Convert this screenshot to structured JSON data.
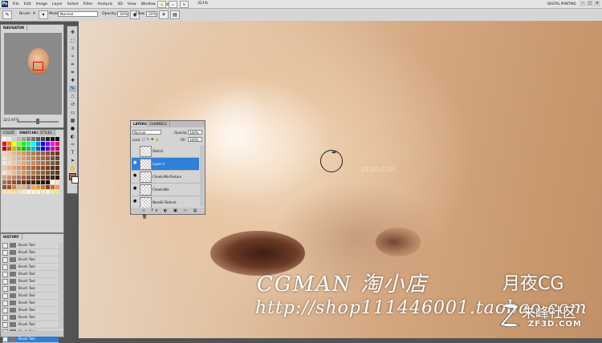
{
  "menubar": {
    "logo": "Ps",
    "menus": [
      "File",
      "Edit",
      "Image",
      "Layer",
      "Select",
      "Filter",
      "Analysis",
      "3D",
      "View",
      "Window",
      "Help"
    ],
    "zoom": "321%",
    "workspace": "DIGITAL PAINTING"
  },
  "options": {
    "brush_label": "Brush:",
    "brush_size": "9",
    "mode_label": "Mode:",
    "mode_value": "Normal",
    "opacity_label": "Opacity:",
    "opacity_value": "30%",
    "flow_label": "Flow:",
    "flow_value": "20%"
  },
  "navigator": {
    "tab": "NAVIGATOR",
    "zoom": "321.97%"
  },
  "swatches": {
    "tabs": [
      "COLOR",
      "SWATCHES",
      "STYLES"
    ],
    "colors": [
      "#ffffff",
      "#e8e8e8",
      "#d0d0d0",
      "#b8b8b8",
      "#a0a0a0",
      "#888888",
      "#707070",
      "#585858",
      "#404040",
      "#282828",
      "#101010",
      "#000000",
      "#ff0000",
      "#ff8000",
      "#ffff00",
      "#80ff00",
      "#00ff00",
      "#00ff80",
      "#00ffff",
      "#0080ff",
      "#0000ff",
      "#8000ff",
      "#ff00ff",
      "#ff0080",
      "#c00000",
      "#c06000",
      "#c0c000",
      "#60c000",
      "#00c000",
      "#00c060",
      "#00c0c0",
      "#0060c0",
      "#0000c0",
      "#6000c0",
      "#c000c0",
      "#c00060",
      "#f4d7c0",
      "#eec6a8",
      "#e6b592",
      "#dea47e",
      "#d4946c",
      "#c8845c",
      "#bc764f",
      "#ae6944",
      "#9e5c3a",
      "#8c4f31",
      "#7a4329",
      "#683822",
      "#f7e0cc",
      "#f0d0b4",
      "#e8c09e",
      "#deb08a",
      "#d4a078",
      "#c89068",
      "#ba825b",
      "#ac744f",
      "#9c6744",
      "#8b5a3b",
      "#7a4e33",
      "#68422b",
      "#fbe9d8",
      "#f4dac4",
      "#ecc9ae",
      "#e3ba9a",
      "#d9aa86",
      "#cd9a74",
      "#c08b65",
      "#b27d58",
      "#a26f4c",
      "#916242",
      "#7f5539",
      "#6c4830",
      "#f2c6a0",
      "#e9b48a",
      "#dfa276",
      "#d49064",
      "#c87f54",
      "#ba6f47",
      "#aa613c",
      "#995433",
      "#88482b",
      "#763d24",
      "#64321e",
      "#522818",
      "#ffe4c8",
      "#f5d0aa",
      "#eabc8f",
      "#dfa977",
      "#d39762",
      "#c5874f",
      "#b67840",
      "#a56a35",
      "#935d2c",
      "#815024",
      "#6f441e",
      "#5d3818",
      "#d9a589",
      "#cc9479",
      "#be846b",
      "#af755e",
      "#a06752",
      "#905a47",
      "#804e3d",
      "#704334",
      "#60382c",
      "#502e24",
      "#40241d",
      "#301a16",
      "#b07050",
      "#a06040",
      "#905030",
      "#804020",
      "#703010",
      "#602000",
      "#502000",
      "#401800",
      "#301000",
      "#200800",
      "#fff0e0",
      "#ffe0c0",
      "#8b5a2b",
      "#a0522d",
      "#cd853f",
      "#deb887",
      "#d2b48c",
      "#bc8f8f",
      "#f4a460",
      "#daa520",
      "#b8860b",
      "#8b4513",
      "#d2691e",
      "#e9967a",
      "#ffdab9",
      "#ffe4b5",
      "#ffdead",
      "#f5deb3",
      "#faebd7",
      "#fff8dc",
      "#fdf5e6",
      "#ffefd5",
      "#ffe4c4",
      "#f5f5dc",
      "#eee8aa",
      "#f0e68c"
    ]
  },
  "history": {
    "tab": "HISTORY",
    "items": [
      "Brush Tool",
      "Brush Tool",
      "Brush Tool",
      "Brush Tool",
      "Brush Tool",
      "Brush Tool",
      "Brush Tool",
      "Brush Tool",
      "Brush Tool",
      "Brush Tool",
      "Brush Tool",
      "Brush Tool",
      "Brush Tool",
      "Brush Tool"
    ]
  },
  "layers": {
    "tabs": [
      "LAYERS",
      "CHANNELS"
    ],
    "blend_mode": "Normal",
    "opacity_label": "Opacity:",
    "opacity_value": "100%",
    "lock_label": "Lock:",
    "fill_label": "Fill:",
    "fill_value": "100%",
    "items": [
      {
        "name": "Sketch",
        "visible": false,
        "active": false
      },
      {
        "name": "Layer 4",
        "visible": true,
        "active": true
      },
      {
        "name": "CheeksMe-Texture",
        "visible": true,
        "active": false
      },
      {
        "name": "CheeksMe",
        "visible": true,
        "active": false
      },
      {
        "name": "NoseEr-Texture",
        "visible": true,
        "active": false
      }
    ]
  },
  "watermark": {
    "line1": "CGMAN 淘小店",
    "line1_right": "月夜CG",
    "line2": "http://shop111446001.taobao.com",
    "site_cn": "朱峰社区",
    "site_en": "ZF3D.COM",
    "faint": "ZF3D.COM"
  },
  "colors": {
    "fg": "#a46c47",
    "bg": "#ffffff",
    "selection": "#2f80d8"
  }
}
